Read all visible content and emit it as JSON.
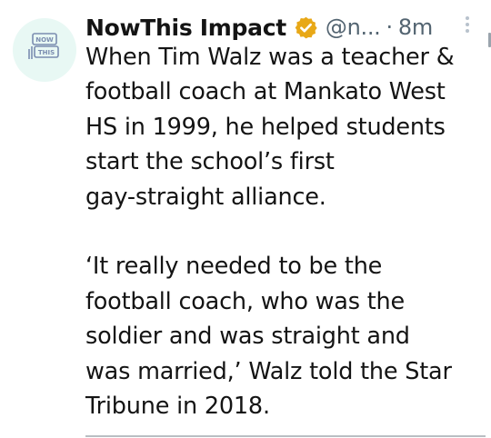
{
  "tweet": {
    "author_name": "NowThis Impact",
    "verified": true,
    "handle": "@n...",
    "separator": "·",
    "time": "8m",
    "avatar": {
      "logo_top": "NOW",
      "logo_bottom": "THIS",
      "bg_color": "#e8f8f4",
      "logo_color": "#7b8db0"
    },
    "text": {
      "paragraph_1": [
        "When Tim Walz was a teacher &",
        "football coach at Mankato West",
        "HS in 1999, he helped students",
        "start the school’s first",
        "gay-straight alliance."
      ],
      "paragraph_2": [
        "‘It really needed to be the",
        "football coach, who was the",
        "soldier and was straight and",
        "was married,’ Walz told the Star",
        "Tribune in 2018."
      ]
    }
  },
  "colors": {
    "verified_badge": "#e8a817",
    "secondary_text": "#536471",
    "primary_text": "#141414"
  }
}
